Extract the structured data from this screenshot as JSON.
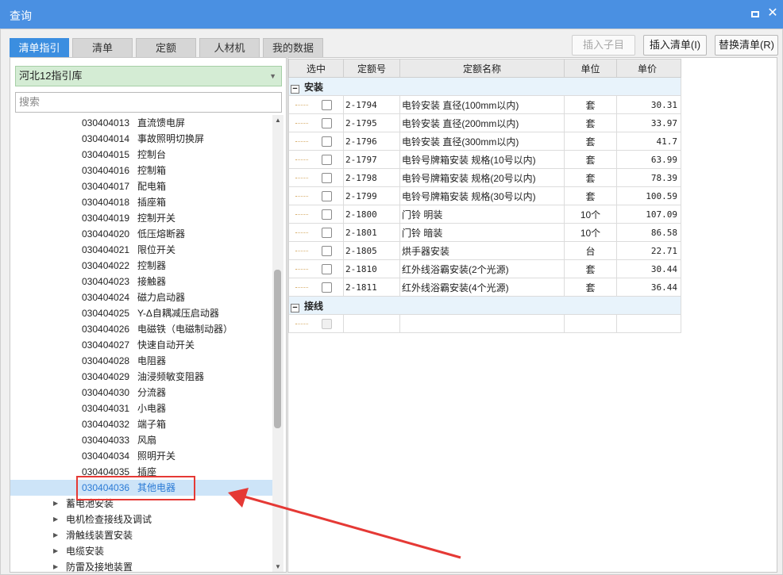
{
  "window": {
    "title": "查询"
  },
  "tabs": [
    {
      "label": "清单指引",
      "active": true
    },
    {
      "label": "清单",
      "active": false
    },
    {
      "label": "定额",
      "active": false
    },
    {
      "label": "人材机",
      "active": false
    },
    {
      "label": "我的数据",
      "active": false
    }
  ],
  "left": {
    "library": "河北12指引库",
    "search_placeholder": "搜索",
    "items": [
      {
        "code": "030404013",
        "name": "直流馈电屏"
      },
      {
        "code": "030404014",
        "name": "事故照明切换屏"
      },
      {
        "code": "030404015",
        "name": "控制台"
      },
      {
        "code": "030404016",
        "name": "控制箱"
      },
      {
        "code": "030404017",
        "name": "配电箱"
      },
      {
        "code": "030404018",
        "name": "插座箱"
      },
      {
        "code": "030404019",
        "name": "控制开关"
      },
      {
        "code": "030404020",
        "name": "低压熔断器"
      },
      {
        "code": "030404021",
        "name": "限位开关"
      },
      {
        "code": "030404022",
        "name": "控制器"
      },
      {
        "code": "030404023",
        "name": "接触器"
      },
      {
        "code": "030404024",
        "name": "磁力启动器"
      },
      {
        "code": "030404025",
        "name": "Y-Δ自耦减压启动器"
      },
      {
        "code": "030404026",
        "name": "电磁铁（电磁制动器）"
      },
      {
        "code": "030404027",
        "name": "快速自动开关"
      },
      {
        "code": "030404028",
        "name": "电阻器"
      },
      {
        "code": "030404029",
        "name": "油浸频敏变阻器"
      },
      {
        "code": "030404030",
        "name": "分流器"
      },
      {
        "code": "030404031",
        "name": "小电器"
      },
      {
        "code": "030404032",
        "name": "端子箱"
      },
      {
        "code": "030404033",
        "name": "风扇"
      },
      {
        "code": "030404034",
        "name": "照明开关"
      },
      {
        "code": "030404035",
        "name": "插座"
      },
      {
        "code": "030404036",
        "name": "其他电器"
      }
    ],
    "categories": [
      "蓄电池安装",
      "电机检查接线及调试",
      "滑触线装置安装",
      "电缆安装",
      "防雷及接地装置"
    ]
  },
  "toolbar": {
    "insert_child": "插入子目",
    "insert_list": "插入清单(I)",
    "replace_list": "替换清单(R)"
  },
  "table": {
    "headers": [
      "选中",
      "定额号",
      "定额名称",
      "单位",
      "单价"
    ],
    "groups": [
      {
        "name": "安装",
        "rows": [
          {
            "code": "2-1794",
            "name": "电铃安装 直径(100mm以内)",
            "unit": "套",
            "price": "30.31"
          },
          {
            "code": "2-1795",
            "name": "电铃安装 直径(200mm以内)",
            "unit": "套",
            "price": "33.97"
          },
          {
            "code": "2-1796",
            "name": "电铃安装 直径(300mm以内)",
            "unit": "套",
            "price": "41.7"
          },
          {
            "code": "2-1797",
            "name": "电铃号牌箱安装 规格(10号以内)",
            "unit": "套",
            "price": "63.99"
          },
          {
            "code": "2-1798",
            "name": "电铃号牌箱安装 规格(20号以内)",
            "unit": "套",
            "price": "78.39"
          },
          {
            "code": "2-1799",
            "name": "电铃号牌箱安装 规格(30号以内)",
            "unit": "套",
            "price": "100.59"
          },
          {
            "code": "2-1800",
            "name": "门铃 明装",
            "unit": "10个",
            "price": "107.09"
          },
          {
            "code": "2-1801",
            "name": "门铃 暗装",
            "unit": "10个",
            "price": "86.58"
          },
          {
            "code": "2-1805",
            "name": "烘手器安装",
            "unit": "台",
            "price": "22.71"
          },
          {
            "code": "2-1810",
            "name": "红外线浴霸安装(2个光源)",
            "unit": "套",
            "price": "30.44"
          },
          {
            "code": "2-1811",
            "name": "红外线浴霸安装(4个光源)",
            "unit": "套",
            "price": "36.44"
          }
        ]
      },
      {
        "name": "接线",
        "rows": [
          {
            "code": "",
            "name": "",
            "unit": "",
            "price": ""
          }
        ]
      }
    ]
  },
  "colors": {
    "accent": "#3b8ee0",
    "highlight": "#e53935",
    "selected_row": "#cde4f8"
  }
}
